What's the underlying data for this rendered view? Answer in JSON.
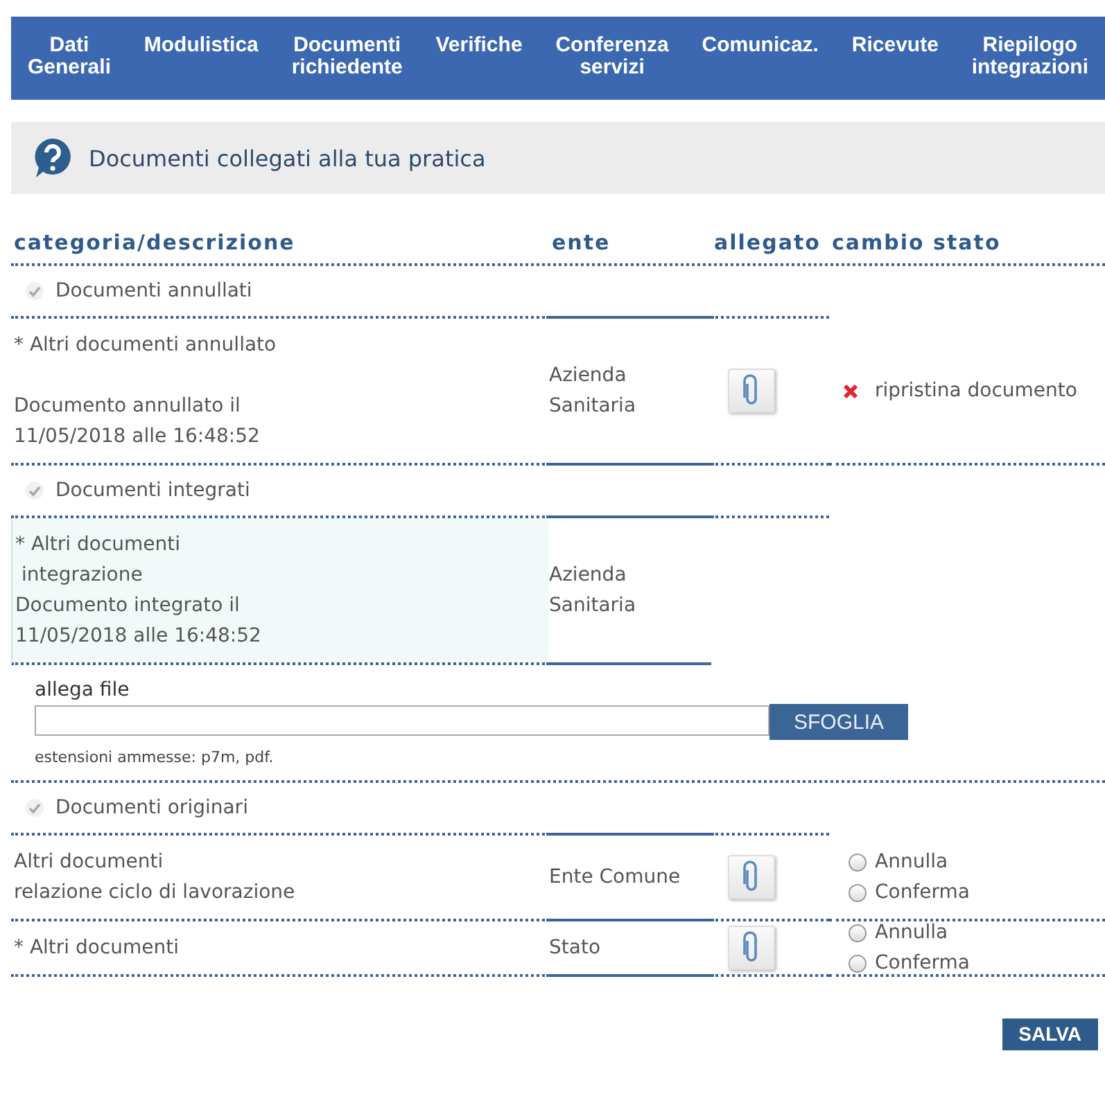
{
  "nav": [
    {
      "label": "Dati\nGenerali"
    },
    {
      "label": "Modulistica"
    },
    {
      "label": "Documenti\nrichiedente"
    },
    {
      "label": "Verifiche"
    },
    {
      "label": "Conferenza\nservizi"
    },
    {
      "label": "Comunicaz."
    },
    {
      "label": "Ricevute"
    },
    {
      "label": "Riepilogo\nintegrazioni"
    }
  ],
  "info_bar": {
    "text": "Documenti collegati alla tua pratica"
  },
  "columns": [
    "categoria/descrizione",
    "ente",
    "allegato",
    "cambio stato"
  ],
  "sections": [
    {
      "title": "Documenti annullati",
      "rows": [
        {
          "description": "* Altri documenti annullato",
          "note": "Documento annullato il\n11/05/2018 alle 16:48:52",
          "ente": "Azienda\nSanitaria",
          "highlighted": false,
          "attachment": true,
          "action": {
            "kind": "restore",
            "label": "ripristina documento"
          }
        }
      ]
    },
    {
      "title": "Documenti integrati",
      "rows": [
        {
          "description": "* Altri documenti\n integrazione",
          "note": "Documento integrato il\n11/05/2018 alle 16:48:52",
          "ente": "Azienda\nSanitaria",
          "highlighted": true,
          "attachment": false,
          "upload": {
            "label": "allega file",
            "button": "SFOGLIA",
            "hint": "estensioni ammesse: p7m, pdf."
          }
        }
      ]
    },
    {
      "title": "Documenti originari",
      "rows": [
        {
          "description": "Altri documenti\nrelazione ciclo di lavorazione",
          "ente": "Ente Comune",
          "highlighted": false,
          "attachment": true,
          "action": {
            "kind": "choice",
            "options": [
              {
                "label": "Annulla",
                "selected": false
              },
              {
                "label": "Conferma",
                "selected": false
              }
            ]
          }
        },
        {
          "description": "* Altri documenti",
          "ente": "Stato",
          "highlighted": false,
          "attachment": true,
          "action": {
            "kind": "choice",
            "options": [
              {
                "label": "Annulla",
                "selected": false
              },
              {
                "label": "Conferma",
                "selected": false
              }
            ]
          }
        }
      ]
    }
  ],
  "save_button": "SALVA"
}
